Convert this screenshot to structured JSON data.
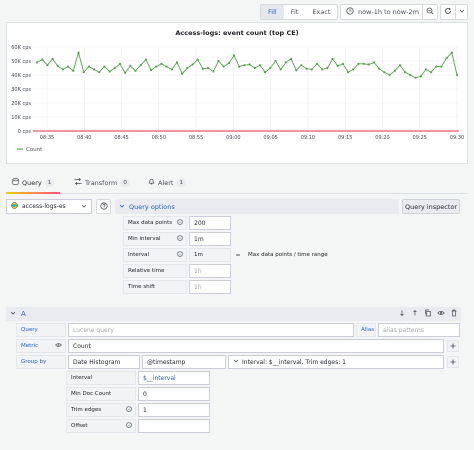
{
  "toolbar": {
    "fill": "Fill",
    "fit": "Fit",
    "exact": "Exact",
    "time_range": "now-1h to now-2m"
  },
  "panel_title": "Access-logs: event count (top CE)",
  "chart_data": {
    "type": "line",
    "title": "Access-logs: event count (top CE)",
    "y_ticks": [
      "0 cps",
      "10K cps",
      "20K cps",
      "30K cps",
      "40K cps",
      "50K cps",
      "60K cps"
    ],
    "ylim": [
      0,
      60000
    ],
    "x_ticks": [
      "08:35",
      "08:40",
      "08:45",
      "08:50",
      "08:55",
      "09:00",
      "09:05",
      "09:10",
      "09:15",
      "09:20",
      "09:25",
      "09:30"
    ],
    "grid": true,
    "legend_position": "bottom-left",
    "series": [
      {
        "name": "Count",
        "color": "#56a64b",
        "values": [
          49000,
          51000,
          47000,
          51500,
          46500,
          44000,
          46000,
          43000,
          56000,
          42000,
          46000,
          44000,
          42000,
          46000,
          42500,
          45000,
          48000,
          41500,
          46500,
          43000,
          47000,
          51000,
          43500,
          46000,
          48000,
          46000,
          44000,
          49000,
          41000,
          45000,
          47500,
          51000,
          44500,
          45000,
          42500,
          50000,
          46000,
          48500,
          54000,
          46000,
          47000,
          47500,
          45000,
          47000,
          42000,
          45000,
          50000,
          44000,
          49000,
          51500,
          43500,
          47000,
          44500,
          44000,
          48000,
          44000,
          45000,
          51500,
          46500,
          48000,
          42000,
          44000,
          48000,
          48000,
          47500,
          49000,
          44500,
          42000,
          40000,
          43000,
          47000,
          42000,
          40000,
          38000,
          39000,
          44000,
          42000,
          46000,
          46000,
          52000,
          56000,
          40000
        ]
      },
      {
        "name": "",
        "color": "#e02f44",
        "values": [
          0
        ]
      }
    ]
  },
  "legend": {
    "count": "Count"
  },
  "tabs": [
    {
      "label": "Query",
      "badge": "1"
    },
    {
      "label": "Transform",
      "badge": "0"
    },
    {
      "label": "Alert",
      "badge": "1"
    }
  ],
  "datasource": {
    "name": "access-logs-es",
    "query_options": "Query options",
    "query_inspector": "Query inspector"
  },
  "options": {
    "max_data_points_label": "Max data points",
    "max_data_points_value": "200",
    "min_interval_label": "Min interval",
    "min_interval_value": "1m",
    "interval_label": "Interval",
    "interval_value": "1m",
    "interval_eq": "=",
    "interval_note": "Max data points / time range",
    "relative_time_label": "Relative time",
    "relative_time_placeholder": "1h",
    "time_shift_label": "Time shift",
    "time_shift_placeholder": "1h"
  },
  "query": {
    "ref_id": "A",
    "query_label": "Query",
    "query_placeholder": "Lucene query",
    "alias_label": "Alias",
    "alias_placeholder": "alias patterns",
    "metric_label": "Metric",
    "metric_value": "Count",
    "group_by_label": "Group by",
    "group_by_type": "Date Histogram",
    "group_by_field": "@timestamp",
    "group_by_summary": "Interval: $__interval, Trim edges: 1",
    "interval_label": "Interval",
    "interval_value": "$__interval",
    "min_doc_count_label": "Min Doc Count",
    "min_doc_count_value": "0",
    "trim_edges_label": "Trim edges",
    "trim_edges_value": "1",
    "offset_label": "Offset",
    "offset_value": ""
  }
}
